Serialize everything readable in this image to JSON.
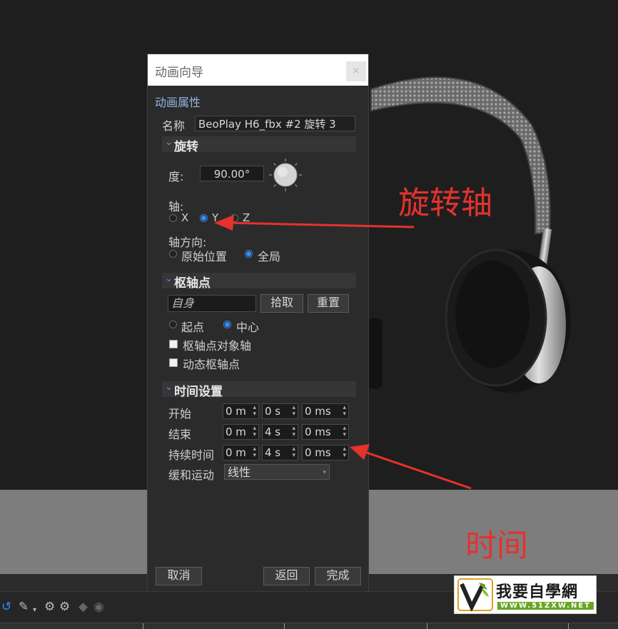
{
  "dialog": {
    "title": "动画向导",
    "close_icon": "×",
    "properties_label": "动画属性",
    "name_label": "名称",
    "name_value": "BeoPlay H6_fbx #2 旋转 3",
    "rotation": {
      "header": "旋转",
      "degree_label": "度:",
      "degree_value": "90.00°",
      "axis_label": "轴:",
      "axis_options": [
        "X",
        "Y",
        "Z"
      ],
      "axis_selected": "Y",
      "axis_direction_label": "轴方向:",
      "direction_options": [
        "原始位置",
        "全局"
      ],
      "direction_selected": "全局"
    },
    "pivot": {
      "header": "枢轴点",
      "pivot_value": "自身",
      "pick_button": "拾取",
      "reset_button": "重置",
      "point_options": [
        "起点",
        "中心"
      ],
      "point_selected": "中心",
      "object_axis_label": "枢轴点对象轴",
      "object_axis_checked": false,
      "dynamic_pivot_label": "动态枢轴点",
      "dynamic_pivot_checked": false
    },
    "time": {
      "header": "时间设置",
      "start_label": "开始",
      "start": [
        "0 m",
        "0 s",
        "0 ms"
      ],
      "end_label": "结束",
      "end": [
        "0 m",
        "4 s",
        "0 ms"
      ],
      "duration_label": "持续时间",
      "duration": [
        "0 m",
        "4 s",
        "0 ms"
      ],
      "easing_label": "缓和运动",
      "easing_value": "线性"
    },
    "cancel_button": "取消",
    "back_button": "返回",
    "finish_button": "完成"
  },
  "annotations": {
    "rotation_axis": "旋转轴",
    "time": "时间"
  },
  "logo": {
    "text": "我要自學網",
    "url": "WWW.51ZXW.NET"
  },
  "colors": {
    "accent": "#3a8cff",
    "annotation": "#e5322d"
  }
}
